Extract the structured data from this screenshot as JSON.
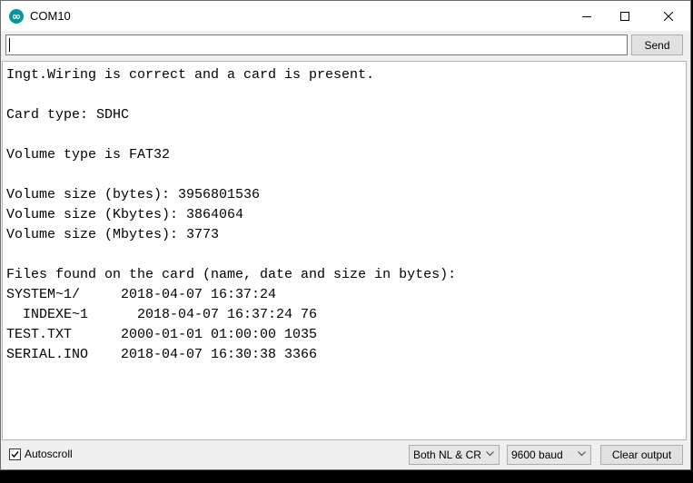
{
  "window": {
    "title": "COM10",
    "icon": "arduino-icon"
  },
  "send_bar": {
    "input_value": "",
    "send_label": "Send"
  },
  "output": {
    "lines": [
      "Ingt.Wiring is correct and a card is present.",
      "",
      "Card type: SDHC",
      "",
      "Volume type is FAT32",
      "",
      "Volume size (bytes): 3956801536",
      "Volume size (Kbytes): 3864064",
      "Volume size (Mbytes): 3773",
      "",
      "Files found on the card (name, date and size in bytes):",
      "SYSTEM~1/     2018-04-07 16:37:24",
      "  INDEXE~1      2018-04-07 16:37:24 76",
      "TEST.TXT      2000-01-01 01:00:00 1035",
      "SERIAL.INO    2018-04-07 16:30:38 3366"
    ]
  },
  "footer": {
    "autoscroll_label": "Autoscroll",
    "autoscroll_checked": true,
    "line_ending": "Both NL & CR",
    "baud_rate": "9600 baud",
    "clear_label": "Clear output"
  }
}
